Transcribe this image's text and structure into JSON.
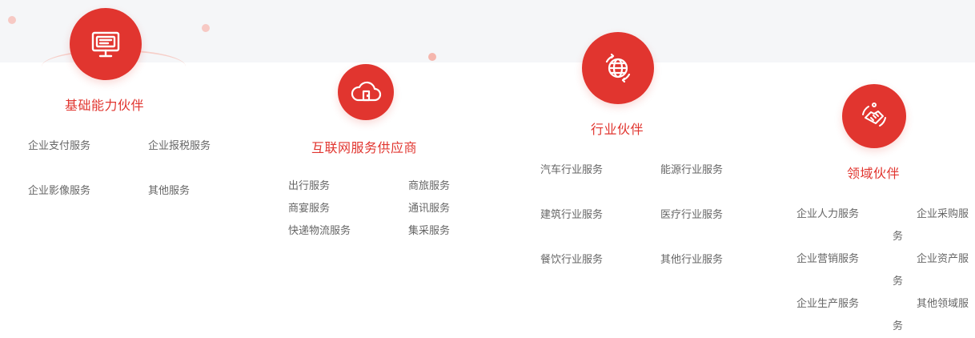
{
  "groups": [
    {
      "icon": "monitor-icon",
      "title": "基础能力伙伴",
      "items": [
        "企业支付服务",
        "企业报税服务",
        "企业影像服务",
        "其他服务"
      ]
    },
    {
      "icon": "cloud-icon",
      "title": "互联网服务供应商",
      "items": [
        "出行服务",
        "商旅服务",
        "商宴服务",
        "通讯服务",
        "快递物流服务",
        "集采服务"
      ]
    },
    {
      "icon": "globe-icon",
      "title": "行业伙伴",
      "items": [
        "汽车行业服务",
        "能源行业服务",
        "建筑行业服务",
        "医疗行业服务",
        "餐饮行业服务",
        "其他行业服务"
      ]
    },
    {
      "icon": "handshake-icon",
      "title": "领域伙伴",
      "items": [
        "企业人力服务",
        "企业采购服务",
        "企业营销服务",
        "企业资产服务",
        "企业生产服务",
        "其他领域服务"
      ]
    }
  ],
  "colors": {
    "accent": "#e1352f",
    "text": "#666666",
    "band": "#f5f6f8"
  }
}
